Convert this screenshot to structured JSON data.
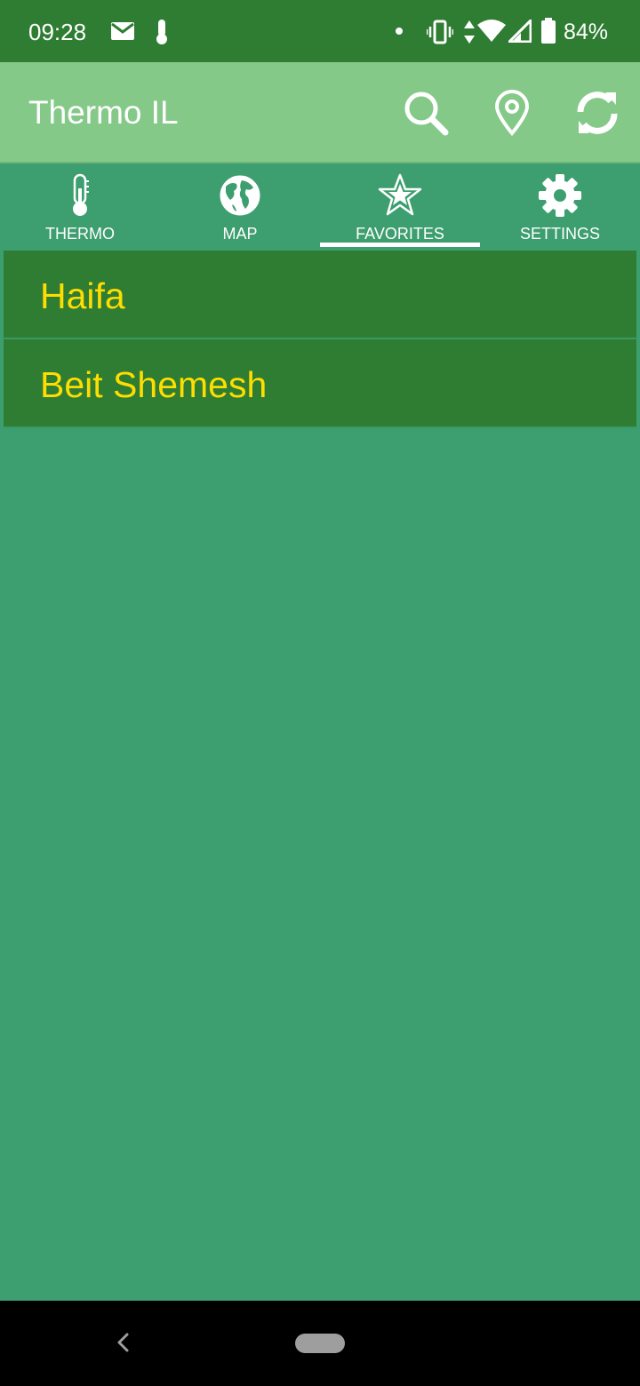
{
  "status_bar": {
    "time": "09:28",
    "battery_percent": "84%",
    "icons": [
      "mail-icon",
      "thermometer-notification-icon",
      "dot-icon",
      "vibrate-icon",
      "data-arrows-icon",
      "wifi-icon",
      "signal-icon",
      "battery-icon"
    ]
  },
  "app_bar": {
    "title": "Thermo IL",
    "actions": [
      "search-icon",
      "location-pin-icon",
      "refresh-icon"
    ]
  },
  "tabs": [
    {
      "label": "THERMO",
      "icon": "thermometer-icon"
    },
    {
      "label": "MAP",
      "icon": "globe-icon"
    },
    {
      "label": "FAVORITES",
      "icon": "star-icon",
      "selected": true
    },
    {
      "label": "SETTINGS",
      "icon": "gear-icon"
    }
  ],
  "favorites": [
    {
      "name": "Haifa"
    },
    {
      "name": "Beit Shemesh"
    }
  ],
  "colors": {
    "status_bar": "#2e7d32",
    "app_bar": "#85c989",
    "background": "#3d9e6f",
    "list_item": "#2e7d32",
    "city_text": "#ffdd00"
  }
}
